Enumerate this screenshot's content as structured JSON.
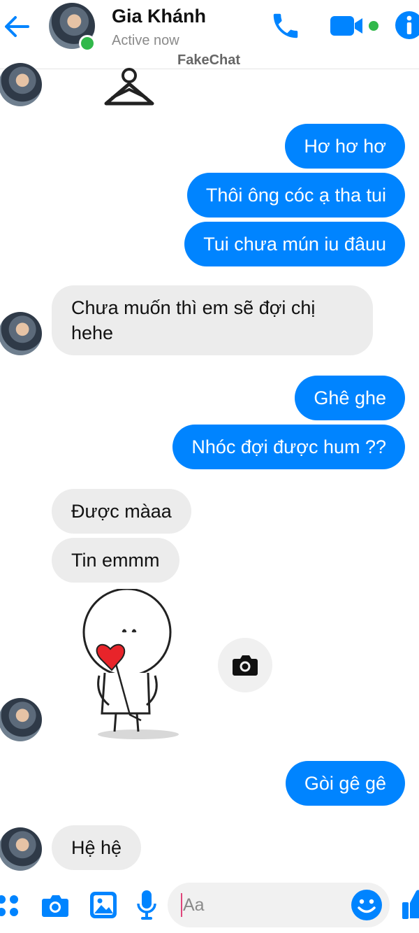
{
  "header": {
    "contact_name": "Gia Khánh",
    "status": "Active now",
    "watermark": "FakeChat"
  },
  "icons": [
    "back-arrow-icon",
    "phone-icon",
    "video-icon",
    "info-icon",
    "apps-icon",
    "camera-icon",
    "gallery-icon",
    "mic-icon",
    "emoji-icon",
    "like-icon"
  ],
  "messages": {
    "m1": "Hơ hơ hơ",
    "m2": "Thôi ông cóc ạ tha tui",
    "m3": "Tui chưa mún iu đâuu",
    "m4": "Chưa muốn thì em sẽ đợi chị hehe",
    "m5": "Ghê ghe",
    "m6": "Nhóc đợi được hum ??",
    "m7": "Được màaa",
    "m8": "Tin emmm",
    "m9": "Gòi gê gê",
    "m10": "Hệ hệ"
  },
  "composer": {
    "placeholder": "Aa"
  },
  "colors": {
    "accent": "#0084ff",
    "incoming_bubble": "#ececec",
    "online": "#31b84a"
  }
}
